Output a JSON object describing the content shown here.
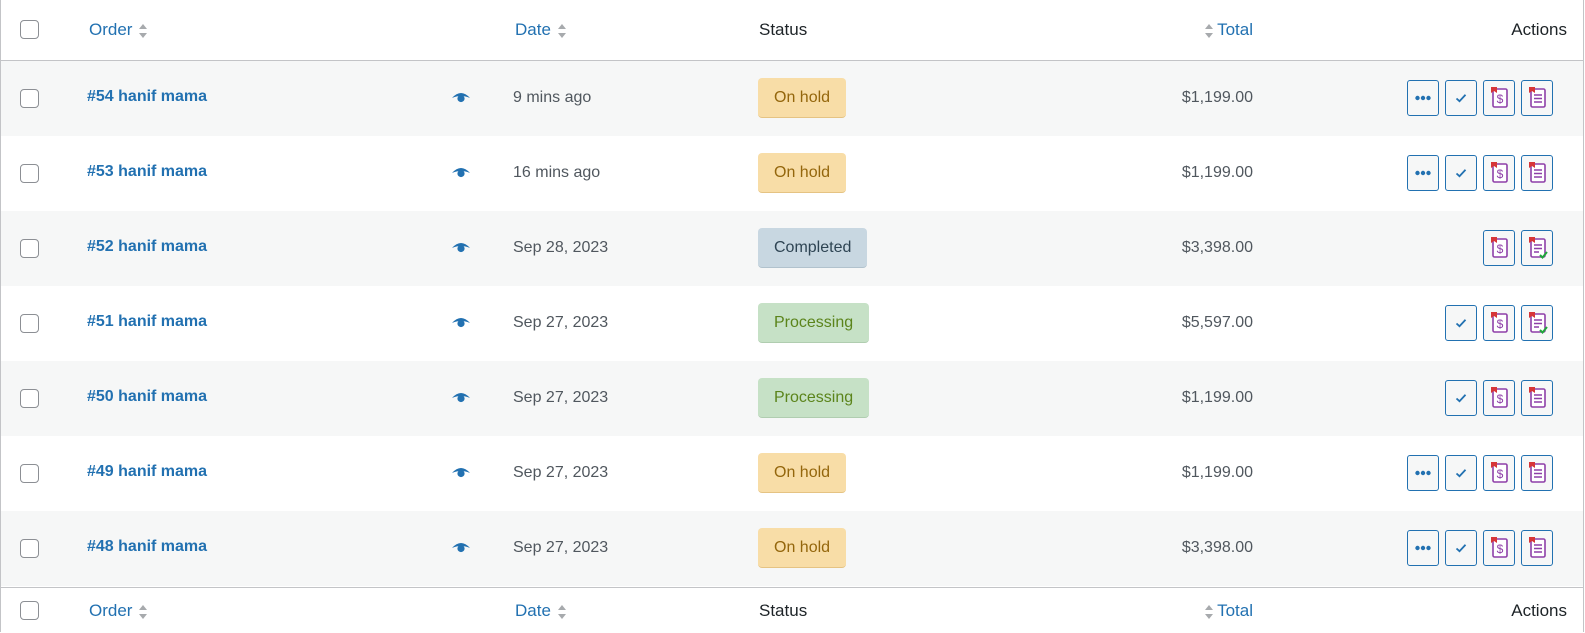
{
  "header": {
    "order_label": "Order",
    "date_label": "Date",
    "status_label": "Status",
    "total_label": "Total",
    "actions_label": "Actions"
  },
  "orders": [
    {
      "title": "#54 hanif mama",
      "date": "9 mins ago",
      "status": "On hold",
      "status_type": "onhold",
      "total": "$1,199.00",
      "actions": [
        "more-icon",
        "complete-icon",
        "invoice-icon",
        "packing-slip-icon"
      ]
    },
    {
      "title": "#53 hanif mama",
      "date": "16 mins ago",
      "status": "On hold",
      "status_type": "onhold",
      "total": "$1,199.00",
      "actions": [
        "more-icon",
        "complete-icon",
        "invoice-icon",
        "packing-slip-icon"
      ]
    },
    {
      "title": "#52 hanif mama",
      "date": "Sep 28, 2023",
      "status": "Completed",
      "status_type": "completed",
      "total": "$3,398.00",
      "actions": [
        "invoice-icon",
        "packing-slip-checked-icon"
      ]
    },
    {
      "title": "#51 hanif mama",
      "date": "Sep 27, 2023",
      "status": "Processing",
      "status_type": "processing",
      "total": "$5,597.00",
      "actions": [
        "complete-icon",
        "invoice-icon",
        "packing-slip-checked-icon"
      ]
    },
    {
      "title": "#50 hanif mama",
      "date": "Sep 27, 2023",
      "status": "Processing",
      "status_type": "processing",
      "total": "$1,199.00",
      "actions": [
        "complete-icon",
        "invoice-icon",
        "packing-slip-icon"
      ]
    },
    {
      "title": "#49 hanif mama",
      "date": "Sep 27, 2023",
      "status": "On hold",
      "status_type": "onhold",
      "total": "$1,199.00",
      "actions": [
        "more-icon",
        "complete-icon",
        "invoice-icon",
        "packing-slip-icon"
      ]
    },
    {
      "title": "#48 hanif mama",
      "date": "Sep 27, 2023",
      "status": "On hold",
      "status_type": "onhold",
      "total": "$3,398.00",
      "actions": [
        "more-icon",
        "complete-icon",
        "invoice-icon",
        "packing-slip-icon"
      ]
    }
  ],
  "colors": {
    "link": "#2271b1",
    "onhold_bg": "#f8dda7",
    "completed_bg": "#c8d7e1",
    "processing_bg": "#c6e1c6"
  }
}
